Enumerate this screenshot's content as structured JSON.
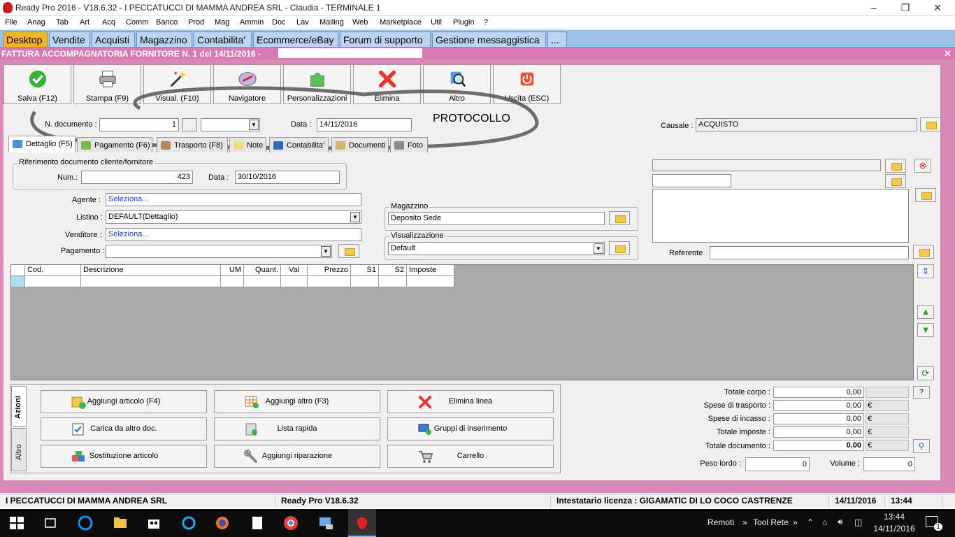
{
  "window": {
    "title": "Ready Pro 2016 - V18.6.32 - I PECCATUCCI DI MAMMA ANDREA SRL - Claudia - TERMINALE 1"
  },
  "menu": [
    "File",
    "Anag",
    "Tab",
    "Art",
    "Acq",
    "Comm",
    "Banco",
    "Prod",
    "Mag",
    "Ammin",
    "Doc",
    "Lav",
    "Mailing",
    "Web",
    "Marketplace",
    "Util",
    "Plugin",
    "?"
  ],
  "tabs": [
    "Desktop",
    "Vendite",
    "Acquisti",
    "Magazzino",
    "Contabilita'",
    "Ecommerce/eBay",
    "Forum di supporto",
    "Gestione messaggistica",
    "..."
  ],
  "doc_title": "FATTURA ACCOMPAGNATORIA FORNITORE N. 1 del 14/11/2016 -",
  "toolbar": [
    "Salva (F12)",
    "Stampa (F9)",
    "Visual. (F10)",
    "Navigatore",
    "Personalizzazioni",
    "Elimina",
    "Altro",
    "Uscita (ESC)"
  ],
  "header": {
    "ndoc_label": "N. documento :",
    "ndoc_value": "1",
    "data_label": "Data :",
    "data_value": "14/11/2016",
    "annotation": "PROTOCOLLO",
    "causale_label": "Causale :",
    "causale_value": "ACQUISTO"
  },
  "doc_tabs": [
    "Dettaglio (F5)",
    "Pagamento (F6)",
    "Trasporto (F8)",
    "Note",
    "Contabilita'",
    "Documenti",
    "Foto"
  ],
  "rif": {
    "title": "Riferimento documento cliente/fornitore",
    "num_label": "Num.:",
    "num_value": "423",
    "data_label": "Data :",
    "data_value": "30/10/2016"
  },
  "fields": {
    "agente_label": "Agente :",
    "agente_value": "Seleziona...",
    "listino_label": "Listino :",
    "listino_value": "DEFAULT(Dettaglio)",
    "venditore_label": "Venditore :",
    "venditore_value": "Seleziona...",
    "pagamento_label": "Pagamento :",
    "pagamento_value": ""
  },
  "magazzino": {
    "title": "Magazzino",
    "value": "Deposito Sede"
  },
  "visualizzazione": {
    "title": "Visualizzazione",
    "value": "Default"
  },
  "referente_label": "Referente",
  "grid_headers": [
    "Cod.",
    "Descrizione",
    "UM",
    "Quant.",
    "Val",
    "Prezzo",
    "S1",
    "S2",
    "Imposte"
  ],
  "side_tabs": [
    "Azioni",
    "Altro"
  ],
  "actions": [
    "Aggiungi articolo (F4)",
    "Aggiungi altro (F3)",
    "Elimina linea",
    "Carica da altro doc.",
    "Lista rapida",
    "Gruppi di inserimento",
    "Sostituzione articolo",
    "Aggiungi riparazione",
    "Carrello"
  ],
  "totals": {
    "corpo_label": "Totale corpo :",
    "corpo_value": "0,00",
    "trasporto_label": "Spese di trasporto :",
    "trasporto_value": "0,00",
    "incasso_label": "Spese di incasso :",
    "incasso_value": "0,00",
    "imposte_label": "Totale imposte :",
    "imposte_value": "0,00",
    "documento_label": "Totale documento :",
    "documento_value": "0,00",
    "currency": "€",
    "help": "?",
    "peso_label": "Peso lordo :",
    "peso_value": "0",
    "volume_label": "Volume :",
    "volume_value": "0"
  },
  "status": {
    "company": "I PECCATUCCI DI MAMMA ANDREA SRL",
    "version": "Ready Pro V18.6.32",
    "license": "Intestatario licenza : GIGAMATIC DI LO COCO CASTRENZE",
    "date": "14/11/2016",
    "time": "13:44"
  },
  "taskbar": {
    "remoti": "Remoti",
    "toolrete": "Tool Rete",
    "time": "13:44",
    "date": "14/11/2016",
    "notif": "1"
  },
  "colors": {
    "accent_tab": "#f6b22e",
    "doc_bg": "#d987b5",
    "tabs_bg": "#9ec2e7"
  }
}
